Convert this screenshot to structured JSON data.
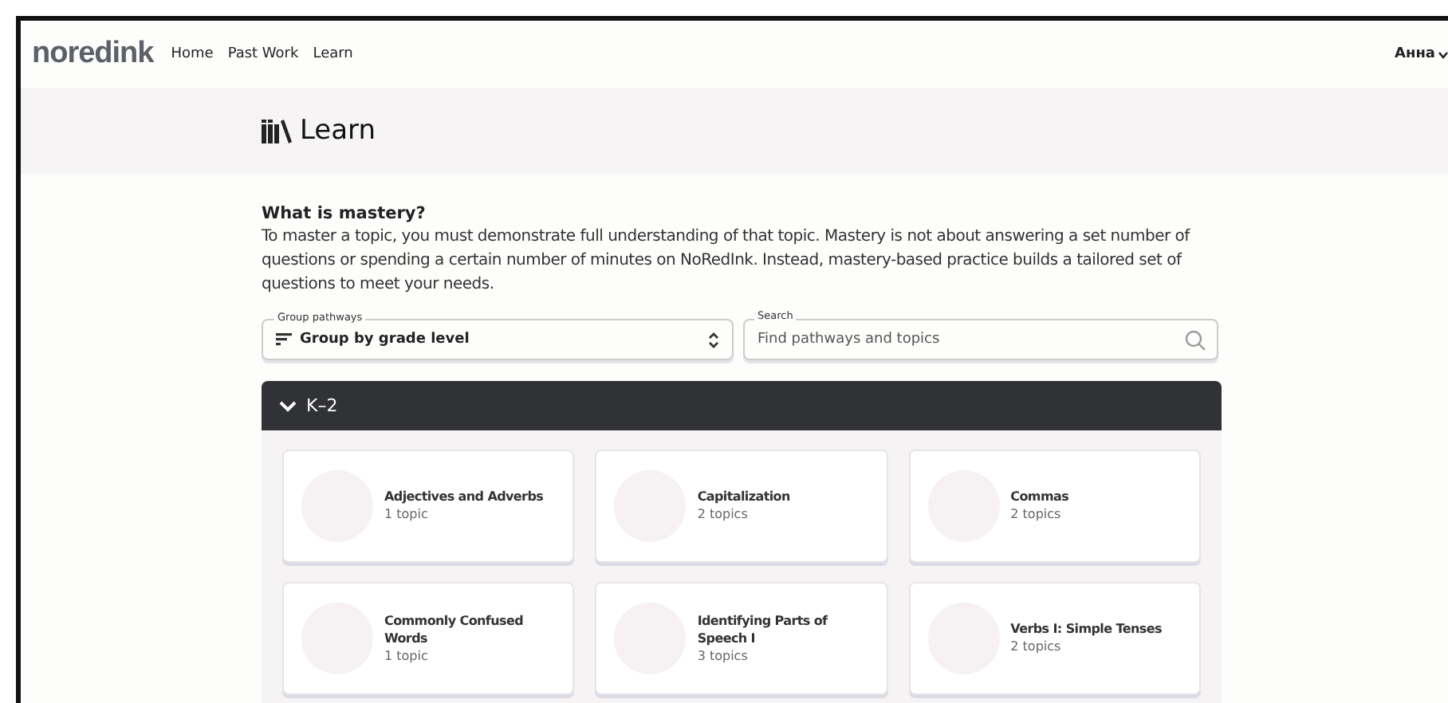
{
  "nav": {
    "logo": "noredink",
    "links": [
      "Home",
      "Past Work",
      "Learn"
    ],
    "user": "Анна"
  },
  "header": {
    "title": "Learn"
  },
  "intro": {
    "heading": "What is mastery?",
    "body": "To master a topic, you must demonstrate full understanding of that topic. Mastery is not about answering a set number of questions or spending a certain number of minutes on NoRedInk. Instead, mastery-based practice builds a tailored set of questions to meet your needs."
  },
  "group_select": {
    "label": "Group pathways",
    "value": "Group by grade level"
  },
  "search": {
    "label": "Search",
    "placeholder": "Find pathways and topics"
  },
  "section": {
    "title": "K–2",
    "expanded": true,
    "cards": [
      {
        "title": "Adjectives and Adverbs",
        "count": "1 topic"
      },
      {
        "title": "Capitalization",
        "count": "2 topics"
      },
      {
        "title": "Commas",
        "count": "2 topics"
      },
      {
        "title": "Commonly Confused Words",
        "count": "1 topic"
      },
      {
        "title": "Identifying Parts of Speech I",
        "count": "3 topics"
      },
      {
        "title": "Verbs I: Simple Tenses",
        "count": "2 topics"
      }
    ]
  }
}
